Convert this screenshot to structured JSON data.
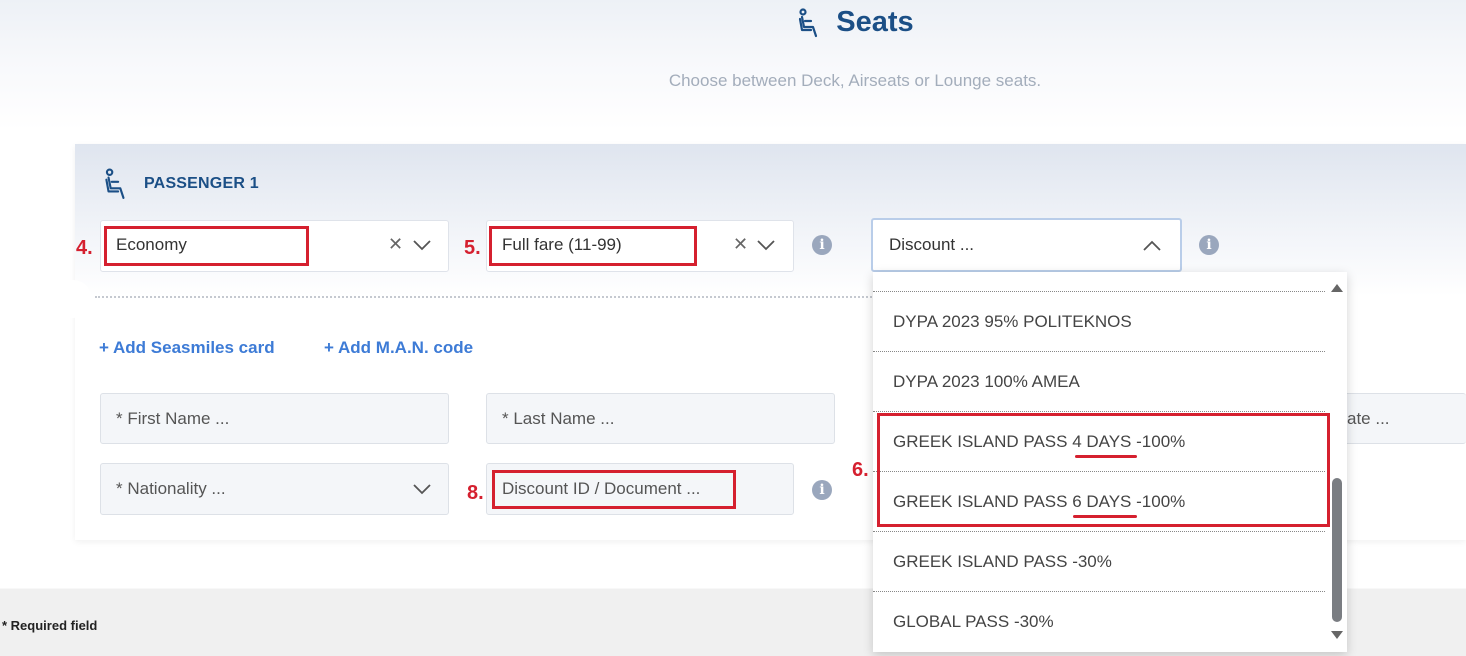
{
  "header": {
    "title": "Seats",
    "subtitle": "Choose between Deck, Airseats or Lounge seats."
  },
  "passenger": {
    "label": "PASSENGER 1",
    "class_select": {
      "value": "Economy"
    },
    "fare_select": {
      "value": "Full fare (11-99)"
    },
    "discount_select": {
      "placeholder": "Discount ..."
    }
  },
  "links": {
    "add_seasmiles": "+ Add Seasmiles card",
    "add_man": "+ Add M.A.N. code"
  },
  "fields": {
    "first_name": "* First Name ...",
    "last_name": "* Last Name ...",
    "birthdate_partial": "ate ...",
    "nationality": "* Nationality ...",
    "discount_id": "Discount ID / Document ..."
  },
  "dropdown_options": [
    "DYPA 2023 95% POLITEKNOS",
    "DYPA 2023 100% AMEA",
    "GREEK ISLAND PASS 4 DAYS -100%",
    "GREEK ISLAND PASS 6 DAYS -100%",
    "GREEK ISLAND PASS -30%",
    "GLOBAL PASS -30%"
  ],
  "annotations": {
    "m4": "4.",
    "m5": "5.",
    "m6": "6.",
    "m8": "8."
  },
  "footer": {
    "required_note": "* Required field"
  },
  "colors": {
    "brand": "#1b4f86",
    "link": "#3d7bd6",
    "annotation": "#d5202f"
  }
}
